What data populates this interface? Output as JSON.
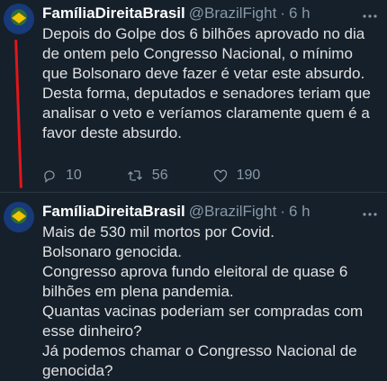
{
  "tweets": [
    {
      "name": "FamíliaDireitaBrasil",
      "handle": "@BrazilFight",
      "time": "6 h",
      "text": "Depois do Golpe dos 6 bilhões aprovado no dia de ontem pelo Congresso Nacional, o mínimo que Bolsonaro deve fazer é vetar este absurdo. Desta forma, deputados e senadores teriam que analisar o veto e veríamos claramente quem é a favor deste absurdo.",
      "replies": "10",
      "retweets": "56",
      "likes": "190"
    },
    {
      "name": "FamíliaDireitaBrasil",
      "handle": "@BrazilFight",
      "time": "6 h",
      "text": "Mais de 530 mil mortos por Covid.\nBolsonaro genocida.\nCongresso aprova fundo eleitoral de quase 6 bilhões em plena pandemia.\nQuantas vacinas poderiam ser compradas com esse dinheiro?\nJá podemos chamar o Congresso Nacional de genocida?"
    }
  ],
  "separator": "·",
  "more_icon": "more-icon",
  "colors": {
    "background": "#15202b",
    "thread_line": "#e0161a"
  }
}
